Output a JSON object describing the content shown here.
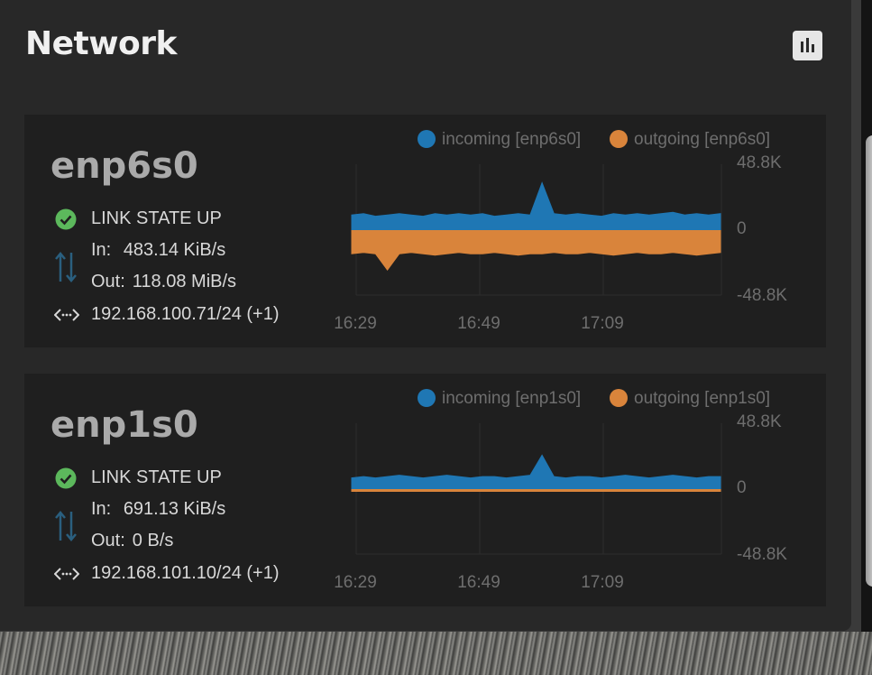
{
  "card": {
    "title": "Network"
  },
  "interfaces": [
    {
      "name": "enp6s0",
      "link_state": "LINK STATE UP",
      "in_label": "In:",
      "in_value": "483.14 KiB/s",
      "out_label": "Out:",
      "out_value": "118.08 MiB/s",
      "address": "192.168.100.71/24 (+1)",
      "chart_data": {
        "type": "area",
        "legend": [
          "incoming [enp6s0]",
          "outgoing [enp6s0]"
        ],
        "y_ticks": [
          "48.8K",
          "0",
          "-48.8K"
        ],
        "x_ticks": [
          "16:29",
          "16:49",
          "17:09"
        ],
        "ylim": [
          -48.8,
          48.8
        ],
        "x": [
          "16:29",
          "16:31",
          "16:33",
          "16:35",
          "16:37",
          "16:39",
          "16:41",
          "16:43",
          "16:45",
          "16:47",
          "16:49",
          "16:51",
          "16:53",
          "16:55",
          "16:57",
          "16:59",
          "17:00",
          "17:01",
          "17:03",
          "17:05",
          "17:07",
          "17:09",
          "17:11",
          "17:13",
          "17:15",
          "17:17",
          "17:19",
          "17:21",
          "17:23",
          "17:25",
          "17:27",
          "17:29"
        ],
        "series": [
          {
            "name": "incoming [enp6s0]",
            "color": "#1f77b4",
            "values": [
              11,
              12,
              10,
              11,
              12,
              11,
              10,
              12,
              11,
              12,
              11,
              12,
              10,
              11,
              12,
              11,
              35,
              12,
              11,
              12,
              11,
              10,
              12,
              11,
              12,
              11,
              12,
              13,
              11,
              12,
              11,
              12
            ]
          },
          {
            "name": "outgoing [enp6s0]",
            "color": "#d9843b",
            "values": [
              -18,
              -17,
              -18,
              -30,
              -18,
              -17,
              -18,
              -19,
              -18,
              -17,
              -18,
              -18,
              -17,
              -18,
              -19,
              -18,
              -18,
              -17,
              -18,
              -18,
              -17,
              -18,
              -19,
              -18,
              -17,
              -18,
              -18,
              -17,
              -18,
              -19,
              -18,
              -17
            ]
          }
        ]
      }
    },
    {
      "name": "enp1s0",
      "link_state": "LINK STATE UP",
      "in_label": "In:",
      "in_value": "691.13 KiB/s",
      "out_label": "Out:",
      "out_value": "0 B/s",
      "address": "192.168.101.10/24 (+1)",
      "chart_data": {
        "type": "area",
        "legend": [
          "incoming [enp1s0]",
          "outgoing [enp1s0]"
        ],
        "y_ticks": [
          "48.8K",
          "0",
          "-48.8K"
        ],
        "x_ticks": [
          "16:29",
          "16:49",
          "17:09"
        ],
        "ylim": [
          -48.8,
          48.8
        ],
        "x": [
          "16:29",
          "16:31",
          "16:33",
          "16:35",
          "16:37",
          "16:39",
          "16:41",
          "16:43",
          "16:45",
          "16:47",
          "16:49",
          "16:51",
          "16:53",
          "16:55",
          "16:57",
          "16:59",
          "17:00",
          "17:01",
          "17:03",
          "17:05",
          "17:07",
          "17:09",
          "17:11",
          "17:13",
          "17:15",
          "17:17",
          "17:19",
          "17:21",
          "17:23",
          "17:25",
          "17:27",
          "17:29"
        ],
        "series": [
          {
            "name": "incoming [enp1s0]",
            "color": "#1f77b4",
            "values": [
              8,
              9,
              8,
              9,
              10,
              9,
              8,
              9,
              10,
              9,
              8,
              9,
              9,
              8,
              9,
              10,
              25,
              9,
              8,
              9,
              9,
              8,
              9,
              10,
              9,
              8,
              9,
              10,
              9,
              8,
              9,
              9
            ]
          },
          {
            "name": "outgoing [enp1s0]",
            "color": "#d9843b",
            "values": [
              -2,
              -2,
              -2,
              -2,
              -2,
              -2,
              -2,
              -2,
              -2,
              -2,
              -2,
              -2,
              -2,
              -2,
              -2,
              -2,
              -2,
              -2,
              -2,
              -2,
              -2,
              -2,
              -2,
              -2,
              -2,
              -2,
              -2,
              -2,
              -2,
              -2,
              -2,
              -2
            ]
          }
        ]
      }
    }
  ],
  "colors": {
    "status_ok": "#5cb85c",
    "incoming": "#1f77b4",
    "outgoing": "#d9843b",
    "arrows": "#2a5f7f"
  }
}
